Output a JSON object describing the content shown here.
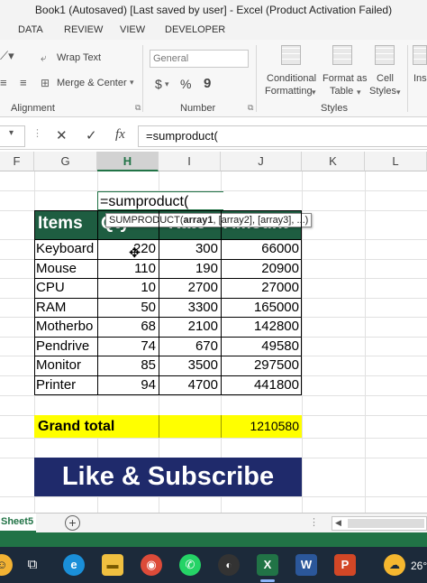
{
  "window": {
    "title": "Book1 (Autosaved) [Last saved by user] - Excel (Product Activation Failed)"
  },
  "ribbon_tabs": [
    "DATA",
    "REVIEW",
    "VIEW",
    "DEVELOPER"
  ],
  "ribbon": {
    "wrap_text": "Wrap Text",
    "merge_center": "Merge & Center",
    "number_format": "General",
    "currency": "$",
    "percent": "%",
    "comma": "9",
    "conditional_formatting": [
      "Conditional",
      "Formatting"
    ],
    "format_as_table": [
      "Format as",
      "Table"
    ],
    "cell_styles": [
      "Cell",
      "Styles"
    ],
    "insert": "Ins",
    "groups": {
      "alignment": "Alignment",
      "number": "Number",
      "styles": "Styles"
    }
  },
  "formula_bar": {
    "value": "=sumproduct("
  },
  "columns": [
    "F",
    "G",
    "H",
    "I",
    "J",
    "K",
    "L"
  ],
  "selected_column": "H",
  "active_cell_text": "=sumproduct(",
  "tooltip": {
    "func": "SUMPRODUCT(",
    "arg1": "array1",
    "rest": ", [array2], [array3], ...)"
  },
  "table": {
    "headers": [
      "Items",
      "Qty",
      "Rate",
      "Amount"
    ],
    "rows": [
      {
        "item": "Keyboard",
        "qty": "220",
        "rate": "300",
        "amount": "66000"
      },
      {
        "item": "Mouse",
        "qty": "110",
        "rate": "190",
        "amount": "20900"
      },
      {
        "item": "CPU",
        "qty": "10",
        "rate": "2700",
        "amount": "27000"
      },
      {
        "item": "RAM",
        "qty": "50",
        "rate": "3300",
        "amount": "165000"
      },
      {
        "item": "Motherbo",
        "qty": "68",
        "rate": "2100",
        "amount": "142800"
      },
      {
        "item": "Pendrive",
        "qty": "74",
        "rate": "670",
        "amount": "49580"
      },
      {
        "item": "Monitor",
        "qty": "85",
        "rate": "3500",
        "amount": "297500"
      },
      {
        "item": "Printer",
        "qty": "94",
        "rate": "4700",
        "amount": "441800"
      }
    ]
  },
  "grand_total": {
    "label": "Grand total",
    "value": "1210580"
  },
  "banner": "Like & Subscribe",
  "sheet_tab": "Sheet5",
  "taskbar": {
    "clock": "26°"
  },
  "colors": {
    "header_green": "#1e5d41",
    "highlight_yellow": "#ffff00",
    "banner_navy": "#1f2a6b",
    "excel_green": "#217346"
  }
}
